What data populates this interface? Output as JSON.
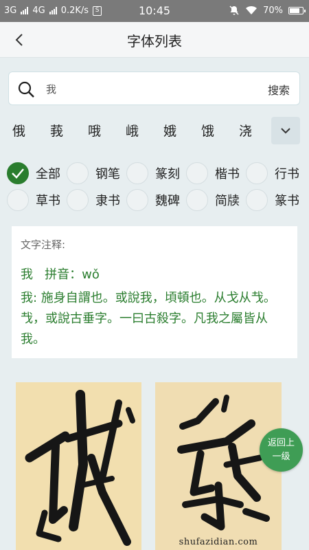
{
  "status_bar": {
    "network_1": "3G",
    "network_2": "4G",
    "speed": "0.2K/s",
    "sim_icon_label": "S",
    "time": "10:45",
    "battery": "70%"
  },
  "header": {
    "title": "字体列表",
    "back_icon": "chevron-left-icon"
  },
  "search": {
    "value": "我",
    "button_label": "搜索",
    "icon": "search-icon"
  },
  "related_chars": [
    "俄",
    "莪",
    "哦",
    "峨",
    "娥",
    "饿",
    "浇"
  ],
  "expand_icon": "chevron-down-icon",
  "filters": [
    {
      "label": "全部",
      "checked": true
    },
    {
      "label": "钢笔",
      "checked": false
    },
    {
      "label": "篆刻",
      "checked": false
    },
    {
      "label": "楷书",
      "checked": false
    },
    {
      "label": "行书",
      "checked": false
    },
    {
      "label": "草书",
      "checked": false
    },
    {
      "label": "隶书",
      "checked": false
    },
    {
      "label": "魏碑",
      "checked": false
    },
    {
      "label": "简牍",
      "checked": false
    },
    {
      "label": "篆书",
      "checked": false
    }
  ],
  "annotation": {
    "heading": "文字注释:",
    "pinyin_line": "我   拼音：wǒ",
    "body": "我: 施身自謂也。或說我，頃頓也。从戈从𢦏。𢦏，或說古垂字。一曰古殺字。凡我之屬皆从我。"
  },
  "images": [
    {
      "name": "calligraphy-image-1",
      "watermark": ""
    },
    {
      "name": "calligraphy-image-2",
      "watermark": "shufazidian.com"
    }
  ],
  "float_button": {
    "line1": "返回上",
    "line2": "一级"
  },
  "colors": {
    "accent_green": "#2a7d2e",
    "float_green": "#3f9d55",
    "status_bar": "#7a7a7a"
  }
}
